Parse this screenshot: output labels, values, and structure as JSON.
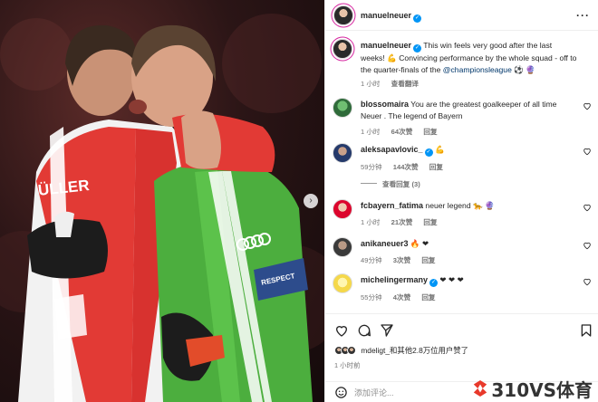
{
  "post": {
    "username": "manuelneuer",
    "more_icon": "more-horizontal-icon",
    "caption_text": "This win feels very good after the last weeks! 💪 Convincing performance by the whole squad - off to the quarter-finals of the",
    "caption_mention": "@championsleague",
    "caption_end": "⚽ 🔮",
    "time": "1 小时",
    "translate": "查看翻译"
  },
  "comments": [
    {
      "username": "blossomaira",
      "text": "You are the greatest goalkeeper of all time Neuer . The legend of Bayern",
      "time": "1 小时",
      "likes": "64次赞",
      "reply": "回复",
      "verified": false
    },
    {
      "username": "aleksapavlovic_",
      "text": "💪",
      "time": "59分钟",
      "likes": "144次赞",
      "reply": "回复",
      "verified": true
    },
    {
      "username": "fcbayern_fatima",
      "text": "neuer legend 🐆 🔮",
      "time": "1 小时",
      "likes": "21次赞",
      "reply": "回复",
      "verified": false
    },
    {
      "username": "anikaneuer3",
      "text": "🔥 ❤",
      "time": "49分钟",
      "likes": "3次赞",
      "reply": "回复",
      "verified": false
    },
    {
      "username": "michelingermany",
      "text": "❤ ❤ ❤",
      "time": "55分钟",
      "likes": "4次赞",
      "reply": "回复",
      "verified": true
    }
  ],
  "view_replies": "查看回复 (3)",
  "actions": {
    "like_icon": "heart-icon",
    "comment_icon": "comment-icon",
    "share_icon": "share-icon",
    "save_icon": "bookmark-icon",
    "likes_text": "mdeligt_和其他2.8万位用户赞了",
    "time": "1 小时前",
    "emoji_icon": "emoji-icon",
    "comment_placeholder": "添加评论..."
  },
  "photo": {
    "jersey_name": "ÜLLER",
    "armband": "RESPECT",
    "next_icon": "chevron-right-icon"
  },
  "watermark": "310VS体育",
  "colors": {
    "accent": "#0095f6",
    "link": "#00376b",
    "muted": "#737373",
    "bayern_red": "#dc052d",
    "keeper_green": "#4cae3e"
  }
}
